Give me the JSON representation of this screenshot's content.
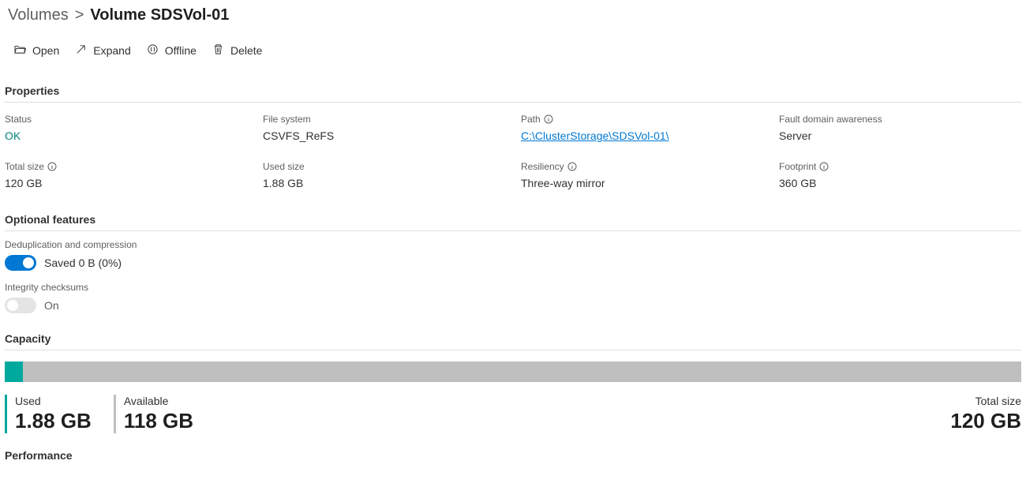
{
  "breadcrumb": {
    "parent": "Volumes",
    "separator": ">",
    "current": "Volume SDSVol-01"
  },
  "toolbar": {
    "open": "Open",
    "expand": "Expand",
    "offline": "Offline",
    "delete": "Delete"
  },
  "sections": {
    "properties_title": "Properties",
    "optional_title": "Optional features",
    "capacity_title": "Capacity",
    "performance_title": "Performance"
  },
  "properties": {
    "status": {
      "label": "Status",
      "value": "OK"
    },
    "file_system": {
      "label": "File system",
      "value": "CSVFS_ReFS"
    },
    "path": {
      "label": "Path",
      "value": "C:\\ClusterStorage\\SDSVol-01\\"
    },
    "fault_domain": {
      "label": "Fault domain awareness",
      "value": "Server"
    },
    "total_size": {
      "label": "Total size",
      "value": "120 GB"
    },
    "used_size": {
      "label": "Used size",
      "value": "1.88 GB"
    },
    "resiliency": {
      "label": "Resiliency",
      "value": "Three-way mirror"
    },
    "footprint": {
      "label": "Footprint",
      "value": "360 GB"
    }
  },
  "features": {
    "dedup": {
      "label": "Deduplication and compression",
      "text": "Saved 0 B (0%)",
      "on": true
    },
    "integrity": {
      "label": "Integrity checksums",
      "text": "On",
      "on": false
    }
  },
  "capacity": {
    "used_label": "Used",
    "used_value": "1.88 GB",
    "avail_label": "Available",
    "avail_value": "118 GB",
    "total_label": "Total size",
    "total_value": "120 GB",
    "fill_percent": 1.8
  },
  "chart_data": {
    "type": "bar",
    "title": "Capacity",
    "categories": [
      "Used",
      "Available"
    ],
    "values": [
      1.88,
      118
    ],
    "unit": "GB",
    "total": 120,
    "xlabel": "",
    "ylabel": "",
    "ylim": [
      0,
      120
    ]
  }
}
